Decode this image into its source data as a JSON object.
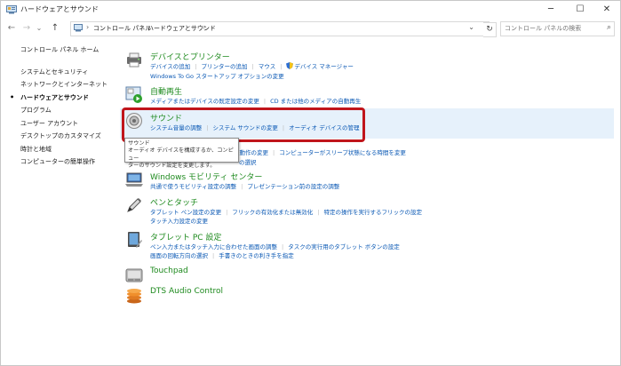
{
  "window": {
    "title": "ハードウェアとサウンド",
    "minimize": "─",
    "maximize": "☐",
    "close": "✕"
  },
  "nav": {
    "back": "←",
    "forward": "→",
    "recent": "⌄",
    "up": "↑",
    "breadcrumbs": [
      "コントロール パネル",
      "ハードウェアとサウンド"
    ],
    "dropdown": "⌄",
    "refresh": "↻",
    "search_placeholder": "コントロール パネルの検索"
  },
  "sidebar": {
    "items": [
      {
        "label": "コントロール パネル ホーム"
      },
      {
        "label": "システムとセキュリティ"
      },
      {
        "label": "ネットワークとインターネット"
      },
      {
        "label": "ハードウェアとサウンド",
        "current": true
      },
      {
        "label": "プログラム"
      },
      {
        "label": "ユーザー アカウント"
      },
      {
        "label": "デスクトップのカスタマイズ"
      },
      {
        "label": "時計と地域"
      },
      {
        "label": "コンピューターの簡単操作"
      }
    ],
    "bullet": "•"
  },
  "categories": {
    "devices": {
      "icon": "printer-icon",
      "title": "デバイスとプリンター",
      "links_row1": [
        "デバイスの追加",
        "プリンターの追加",
        "マウス",
        "デバイス マネージャー"
      ],
      "links_row2": [
        "Windows To Go スタートアップ オプションの変更"
      ]
    },
    "autoplay": {
      "icon": "autoplay-icon",
      "title": "自動再生",
      "links_row1": [
        "メディアまたはデバイスの既定設定の変更",
        "CD または他のメディアの自動再生"
      ]
    },
    "sound": {
      "icon": "speaker-icon",
      "title": "サウンド",
      "links_row1": [
        "システム音量の調整",
        "システム サウンドの変更",
        "オーディオ デバイスの管理"
      ]
    },
    "power": {
      "partial_row1": [
        "の動作の変更",
        "コンピューターがスリープ状態になる時間を変更"
      ],
      "partial_row2": "の選択"
    },
    "mobility": {
      "icon": "mobility-center-icon",
      "title": "Windows モビリティ センター",
      "links_row1": [
        "共通で使うモビリティ設定の調整",
        "プレゼンテーション前の設定の調整"
      ]
    },
    "pen": {
      "icon": "pen-touch-icon",
      "title": "ペンとタッチ",
      "links_row1": [
        "タブレット ペン設定の変更",
        "フリックの有効化または無効化",
        "特定の操作を実行するフリックの設定"
      ],
      "links_row2": [
        "タッチ入力設定の変更"
      ]
    },
    "tablet": {
      "icon": "tablet-pc-icon",
      "title": "タブレット PC 設定",
      "links_row1": [
        "ペン入力またはタッチ入力に合わせた画面の調整",
        "タスクの実行用のタブレット ボタンの設定"
      ],
      "links_row2": [
        "画面の回転方向の選択",
        "手書きのときの利き手を指定"
      ]
    },
    "touchpad": {
      "icon": "touchpad-icon",
      "title": "Touchpad"
    },
    "dts": {
      "icon": "dts-audio-icon",
      "title": "DTS Audio Control"
    }
  },
  "tooltip": {
    "line1": "サウンド",
    "line2": "オーディオ デバイスを構成するか、コンピュー",
    "line3": "ターのサウンド設定を変更します。"
  },
  "colors": {
    "category_title": "#1e8a1e",
    "link": "#0a58b4",
    "highlight": "#e6f1fb",
    "annotation_box": "#c0151b"
  }
}
